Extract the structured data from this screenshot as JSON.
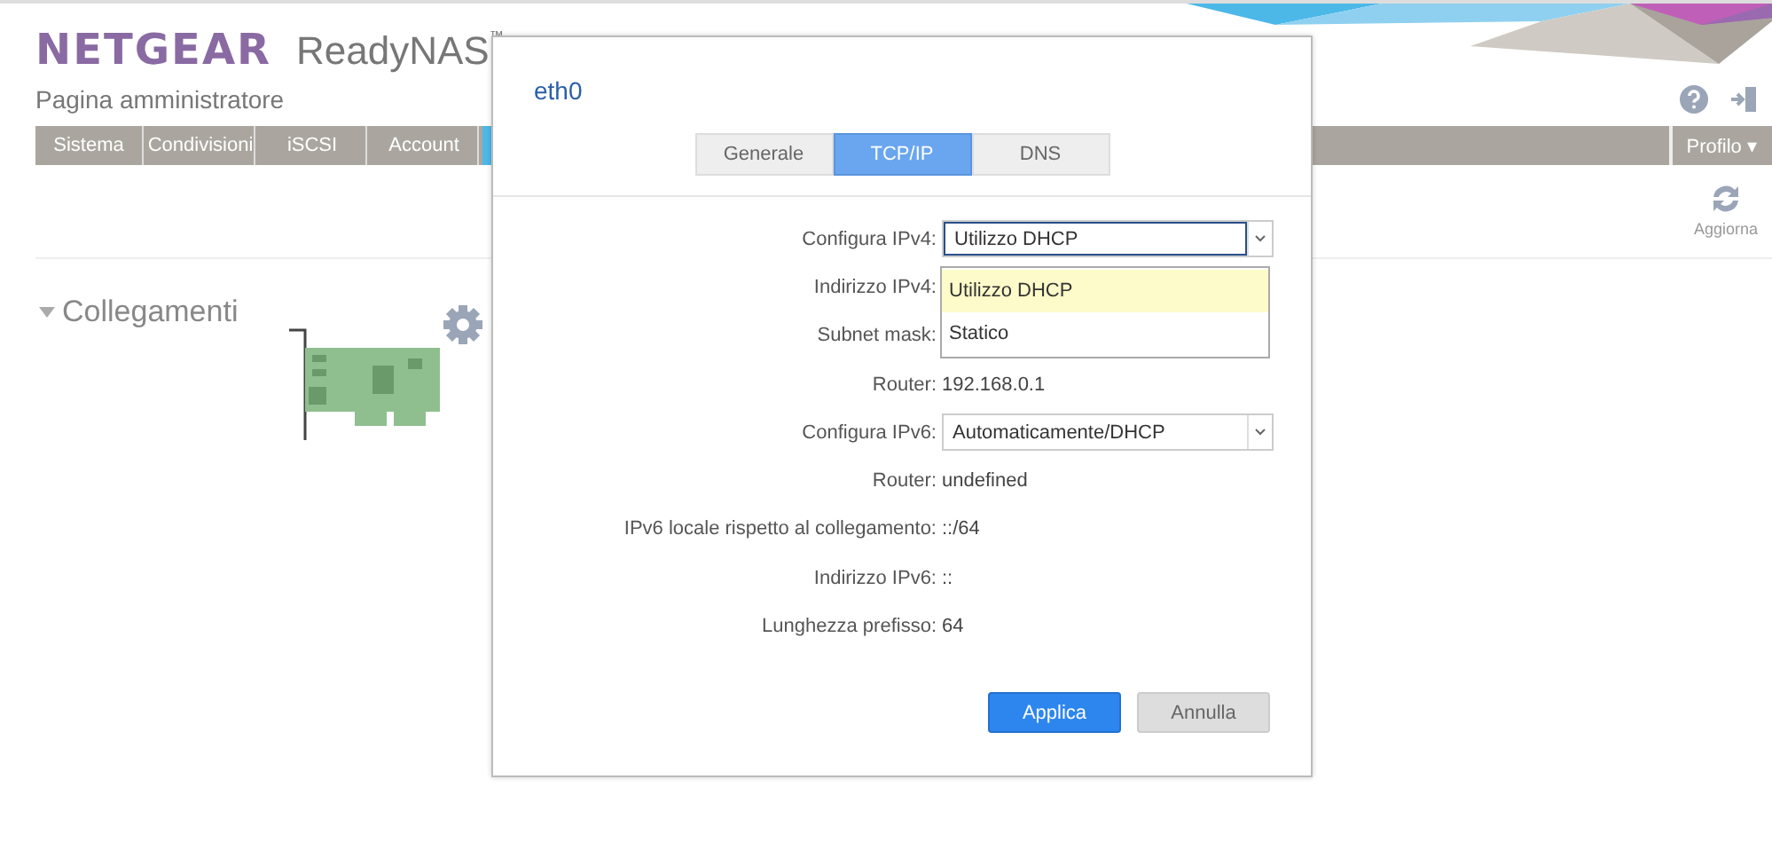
{
  "header": {
    "brand": "NETGEAR",
    "product": "ReadyNAS",
    "trademark": "™",
    "subtitle": "Pagina amministratore"
  },
  "nav": [
    {
      "label": "Sistema",
      "selected": false
    },
    {
      "label": "Condivisioni",
      "selected": false
    },
    {
      "label": "iSCSI",
      "selected": false
    },
    {
      "label": "Account",
      "selected": false
    },
    {
      "selected": true
    }
  ],
  "profile_menu": {
    "label": "Profilo ▾"
  },
  "refresh": {
    "label": "Aggiorna"
  },
  "section": {
    "title": "Collegamenti",
    "expanded": true
  },
  "dialog": {
    "title": "eth0",
    "tabs": [
      {
        "label": "Generale",
        "selected": false
      },
      {
        "label": "TCP/IP",
        "selected": true
      },
      {
        "label": "DNS",
        "selected": false
      }
    ],
    "fields": [
      {
        "kind": "select",
        "label": "Configura IPv4:",
        "value": "Utilizzo DHCP",
        "focused": true
      },
      {
        "kind": "text",
        "label": "Indirizzo IPv4:"
      },
      {
        "kind": "text",
        "label": "Subnet mask:"
      },
      {
        "kind": "text",
        "label": "Router:",
        "value": "192.168.0.1"
      },
      {
        "kind": "select",
        "label": "Configura IPv6:",
        "value": "Automaticamente/DHCP",
        "focused": false
      },
      {
        "kind": "text",
        "label": "Router:",
        "value": "undefined"
      },
      {
        "kind": "text",
        "label": "IPv6 locale rispetto al collegamento:",
        "value": "::/64"
      },
      {
        "kind": "text",
        "label": "Indirizzo IPv6:",
        "value": "::"
      },
      {
        "kind": "text",
        "label": "Lunghezza prefisso:",
        "value": "64"
      }
    ],
    "dropdown": [
      {
        "label": "Utilizzo DHCP",
        "selected": true
      },
      {
        "label": "Statico",
        "selected": false
      }
    ],
    "buttons": [
      {
        "label": "Applica",
        "kind": "primary"
      },
      {
        "label": "Annulla",
        "kind": "secondary"
      }
    ]
  }
}
